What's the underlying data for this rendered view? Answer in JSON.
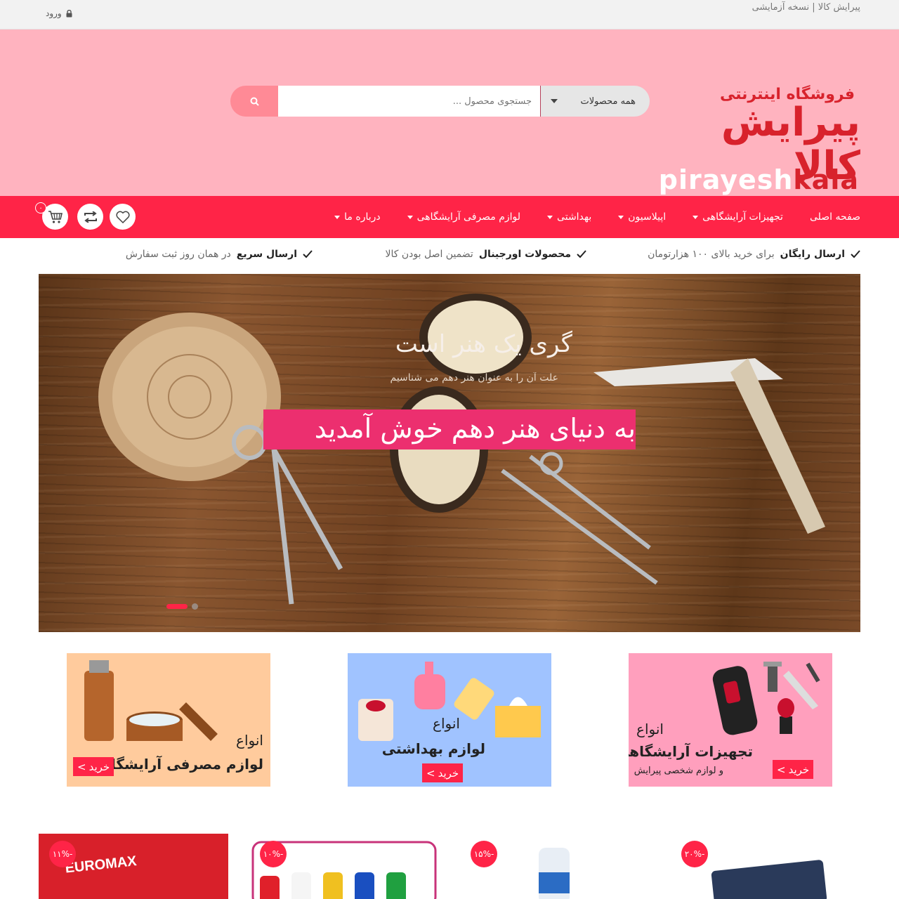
{
  "topbar": {
    "site_note": "پیرایش کالا | نسخه آزمایشی",
    "login_label": "ورود"
  },
  "logo": {
    "line1": "فروشگاه اینترنتی",
    "line2": "پیرایش کالا",
    "latin_a": "pirayesh",
    "latin_b": "kala"
  },
  "search": {
    "placeholder": "جستجوی محصول ...",
    "category": "همه محصولات"
  },
  "nav": {
    "items": [
      {
        "label": "صفحه اصلی",
        "dropdown": false
      },
      {
        "label": "تجهیزات آرایشگاهی",
        "dropdown": true
      },
      {
        "label": "اپیلاسیون",
        "dropdown": true
      },
      {
        "label": "بهداشتی",
        "dropdown": true
      },
      {
        "label": "لوازم مصرفی آرایشگاهی",
        "dropdown": true
      },
      {
        "label": "درباره ما",
        "dropdown": true
      }
    ],
    "cart_count": "۰"
  },
  "features": [
    {
      "bold": "ارسال رایگان",
      "text": "برای خرید بالای ۱۰۰ هزارتومان"
    },
    {
      "bold": "محصولات اورجینال",
      "text": "تضمین اصل بودن کالا"
    },
    {
      "bold": "ارسال سریع",
      "text": "در همان روز ثبت سفارش"
    }
  ],
  "slider": {
    "title": "گری یک هنر است",
    "subtitle": "علت آن را به عنوان هنر دهم می شناسیم",
    "headline": "به دنیای هنر دهم خوش آمدید",
    "active_slide": 2
  },
  "banners": [
    {
      "line1": "انواع",
      "line2": "تجهیزات آرایشگاهی",
      "line3": "و لوازم شخصی پیرایش",
      "buy": "خرید",
      "color": "#ff9fbd"
    },
    {
      "line1": "انواع",
      "line2": "لوازم بهداشتی",
      "line3": "",
      "buy": "خرید",
      "color": "#a0c3ff"
    },
    {
      "line1": "انواع",
      "line2": "لوازم مصرفی آرایشگاهی",
      "line3": "",
      "buy": "خرید",
      "color": "#ffcb9d"
    }
  ],
  "products": [
    {
      "discount": "-۲۰%"
    },
    {
      "discount": "-۱۵%"
    },
    {
      "discount": "-۱۰%"
    },
    {
      "discount": "-۱۱%"
    }
  ],
  "colors": {
    "brand": "#ff2447",
    "header_bg": "#ffb3bf",
    "logo_red": "#d8222c"
  }
}
